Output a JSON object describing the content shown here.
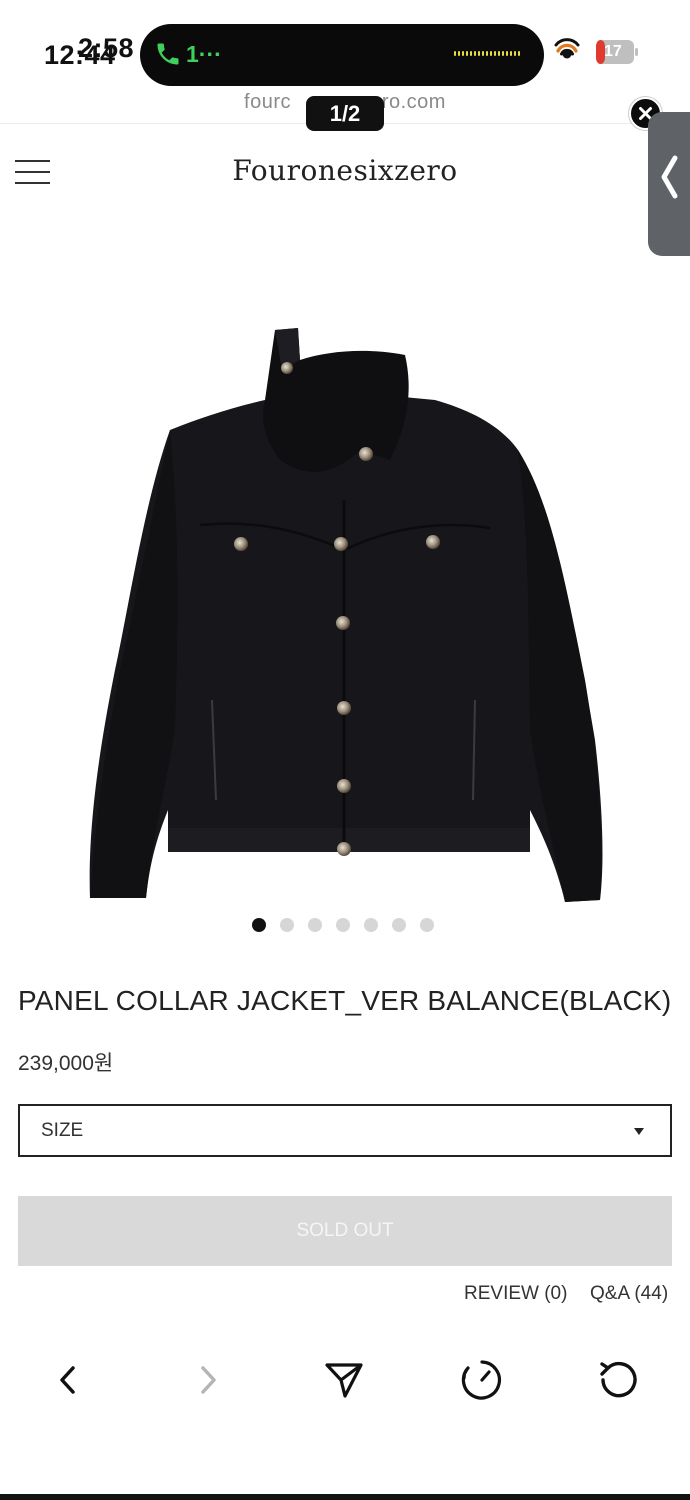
{
  "status_bar": {
    "time": "12:44",
    "time_ghost": "2:58",
    "call_text": "1···",
    "battery_level": "17",
    "colors": {
      "call_green": "#3ed05a",
      "waveform_yellow": "#e8dd3a",
      "battery_red": "#e03a2f"
    },
    "icons": [
      "phone-icon",
      "waveform-icon",
      "hotspot-icon",
      "battery-icon"
    ]
  },
  "browser": {
    "url_text": "fourc               ro.com",
    "page_indicator": "1/2",
    "close_icon": "close-icon",
    "side_handle_icon": "chevron-left-icon"
  },
  "header": {
    "brand": "Fouronesixzero",
    "menu_icon": "hamburger-menu-icon"
  },
  "product": {
    "image_alt": "black-jacket-image",
    "image_count": 7,
    "active_image_index": 0,
    "title": "PANEL COLLAR JACKET_VER BALANCE(BLACK)",
    "price": "239,000원",
    "size_select_label": "SIZE",
    "sold_out_label": "SOLD OUT",
    "review_link": "REVIEW (0)",
    "qa_link": "Q&A (44)"
  },
  "toolbar": {
    "buttons": [
      {
        "name": "back-button",
        "icon": "chevron-left-icon",
        "enabled": true
      },
      {
        "name": "forward-button",
        "icon": "chevron-right-icon",
        "enabled": false
      },
      {
        "name": "share-button",
        "icon": "send-icon",
        "enabled": true
      },
      {
        "name": "timer-button",
        "icon": "timer-icon",
        "enabled": true
      },
      {
        "name": "refresh-button",
        "icon": "refresh-icon",
        "enabled": true
      }
    ]
  }
}
